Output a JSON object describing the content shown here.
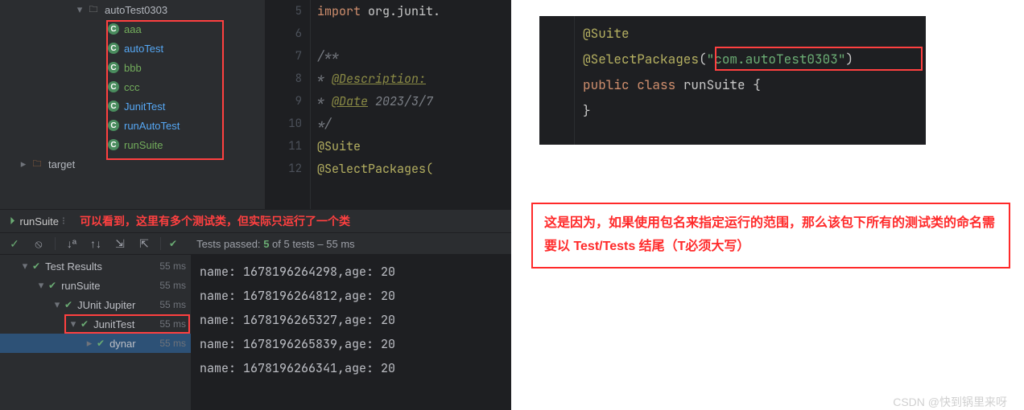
{
  "tree": {
    "folder": "autoTest0303",
    "items": [
      {
        "label": "aaa",
        "cls": "green-label"
      },
      {
        "label": "autoTest",
        "cls": "blue-label"
      },
      {
        "label": "bbb",
        "cls": "green-label"
      },
      {
        "label": "ccc",
        "cls": "green-label"
      },
      {
        "label": "JunitTest",
        "cls": "blue-label"
      },
      {
        "label": "runAutoTest",
        "cls": "blue-label"
      },
      {
        "label": "runSuite",
        "cls": "green-label"
      }
    ],
    "target": "target"
  },
  "editor": {
    "lineNumbers": [
      "5",
      "6",
      "7",
      "8",
      "9",
      "10",
      "11",
      "12"
    ],
    "l5a": "import ",
    "l5b": "org.junit.",
    "l7": "/**",
    "l8a": " * ",
    "l8b": "@Description:",
    "l9a": " * ",
    "l9b": "@Date",
    "l9c": " 2023/3/7",
    "l10": " */",
    "l11": "@Suite",
    "l12": "@SelectPackages("
  },
  "run": {
    "tab": "runSuite",
    "annotation": "可以看到，这里有多个测试类，但实际只运行了一个类",
    "passed_prefix": "Tests passed:",
    "passed_count": "5",
    "passed_suffix": "of 5 tests – 55 ms",
    "tests": [
      {
        "label": "Test Results",
        "indent": 24,
        "time": "55 ms",
        "chev": true
      },
      {
        "label": "runSuite",
        "indent": 44,
        "time": "55 ms",
        "chev": true
      },
      {
        "label": "JUnit Jupiter",
        "indent": 64,
        "time": "55 ms",
        "chev": true
      },
      {
        "label": "JunitTest",
        "indent": 84,
        "time": "55 ms",
        "chev": true,
        "boxed": true
      },
      {
        "label": "dynar",
        "indent": 104,
        "time": "55 ms",
        "chev": false,
        "selected": true
      }
    ],
    "console": [
      "name: 1678196264298,age: 20",
      "name: 1678196264812,age: 20",
      "name: 1678196265327,age: 20",
      "name: 1678196265839,age: 20",
      "name: 1678196266341,age: 20"
    ]
  },
  "snippet": {
    "l1": "@Suite",
    "l2a": "@SelectPackages",
    "l2b": "(",
    "l2c": "\"com.autoTest0303\"",
    "l2d": ")",
    "l3a": "public ",
    "l3b": "class ",
    "l3c": "runSuite",
    "l3d": " {",
    "l4": "}"
  },
  "explain": "这是因为，如果使用包名来指定运行的范围，那么该包下所有的测试类的命名需要以 Test/Tests 结尾（T必须大写）",
  "watermark": "CSDN @快到锅里来呀"
}
